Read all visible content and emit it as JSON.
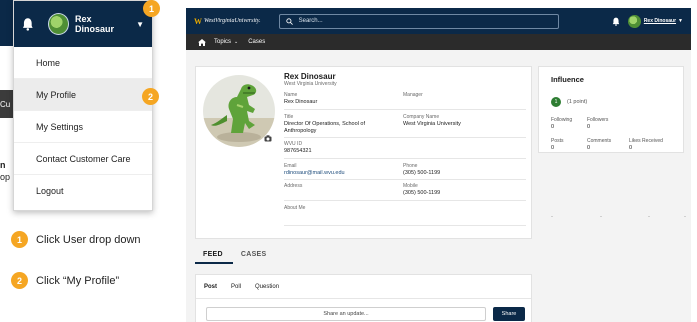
{
  "colors": {
    "navy": "#0b2948",
    "accent": "#f5a623",
    "nav_dark": "#2b2b2b",
    "influence_green": "#2e7d32"
  },
  "dropdown": {
    "user_name": "Rex Dinosaur",
    "items": [
      "Home",
      "My Profile",
      "My Settings",
      "Contact Customer Care",
      "Logout"
    ],
    "highlighted_index": 1,
    "icons": [
      "bell-icon",
      "avatar",
      "caret-down-icon"
    ]
  },
  "badges": {
    "one": "1",
    "two": "2"
  },
  "instructions": [
    {
      "number": "1",
      "text": "Click User drop down"
    },
    {
      "number": "2",
      "text": "Click “My Profile”"
    }
  ],
  "fragments": {
    "cu": "Cu",
    "n": "n",
    "op": "op"
  },
  "app": {
    "logo_text": "WestVirginiaUniversity.",
    "search_placeholder": "Search...",
    "header_user": "Rex Dinosaur",
    "nav": {
      "topics": "Topics",
      "cases": "Cases"
    },
    "profile": {
      "name": "Rex Dinosaur",
      "university": "West Virginia University",
      "name_label": "Name",
      "name_value": "Rex Dinosaur",
      "manager_label": "Manager",
      "title_label": "Title",
      "title_line1": "Director Of Operations, School of",
      "title_line2": "Anthropology",
      "company_label": "Company Name",
      "company_value": "West Virginia University",
      "wvu_label": "WVU ID",
      "wvu_value": "987654321",
      "email_label": "Email",
      "email_value": "rdinosaur@mail.wvu.edu",
      "phone_label": "Phone",
      "phone_value": "(305) 500-1199",
      "address_label": "Address",
      "mobile_label": "Mobile",
      "mobile_value": "(305) 500-1199",
      "about_label": "About Me"
    },
    "influence": {
      "title": "Influence",
      "level": "1",
      "points": "(1 point)",
      "following_label": "Following",
      "following": "0",
      "followers_label": "Followers",
      "followers": "0",
      "posts_label": "Posts",
      "posts": "0",
      "comments_label": "Comments",
      "comments": "0",
      "likes_label": "Likes Received",
      "likes": "0"
    },
    "feed_tabs": [
      "FEED",
      "CASES"
    ],
    "post_tabs": [
      "Post",
      "Poll",
      "Question"
    ],
    "share_placeholder": "Share an update...",
    "share_button": "Share"
  }
}
